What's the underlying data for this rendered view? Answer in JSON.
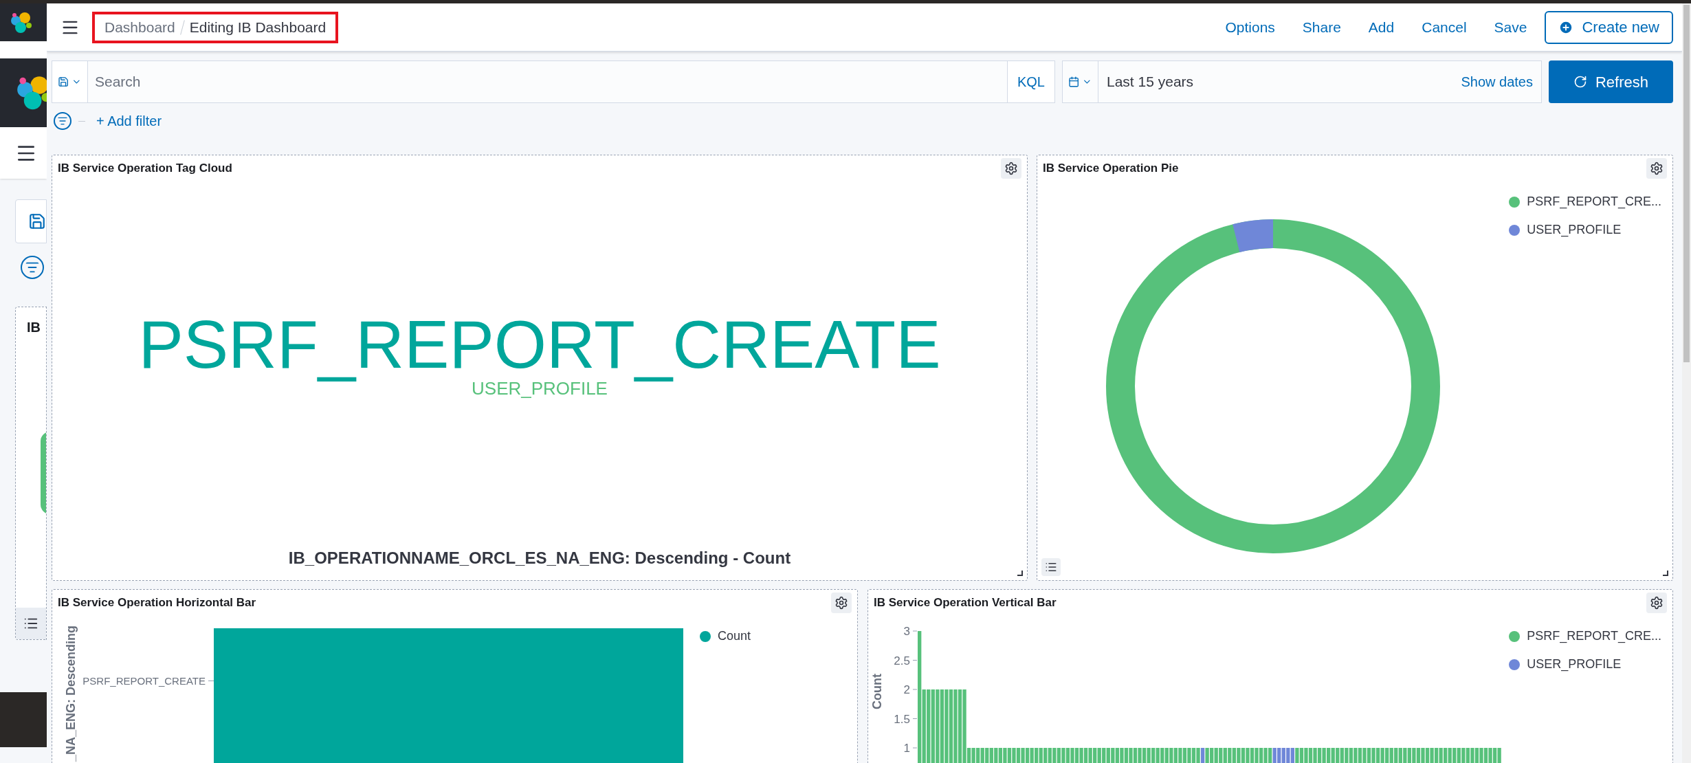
{
  "background_window": {
    "panel_title": "IB"
  },
  "header": {
    "breadcrumbs": {
      "highlighted": true,
      "items": [
        {
          "label": "Dashboard",
          "current": false
        },
        {
          "label": "Editing IB Dashboard",
          "current": true
        }
      ]
    },
    "actions": [
      {
        "label": "Options",
        "kind": "link"
      },
      {
        "label": "Share",
        "kind": "link"
      },
      {
        "label": "Add",
        "kind": "link"
      },
      {
        "label": "Cancel",
        "kind": "link"
      },
      {
        "label": "Save",
        "kind": "link"
      },
      {
        "label": "Create new",
        "kind": "create"
      }
    ]
  },
  "query_bar": {
    "search": {
      "placeholder": "Search"
    },
    "language": "KQL",
    "time": {
      "value": "Last 15 years",
      "toggle": "Show dates"
    },
    "refresh": "Refresh"
  },
  "filter_bar": {
    "add_filter": "+ Add filter"
  },
  "panels": [
    {
      "kind": "tag_cloud",
      "title": "IB Service Operation Tag Cloud",
      "words": [
        {
          "text": "PSRF_REPORT_CREATE",
          "kind": "large",
          "color": "#00a69b"
        },
        {
          "text": "USER_PROFILE",
          "kind": "small",
          "color": "#57c17b"
        }
      ],
      "caption": "IB_OPERATIONNAME_ORCL_ES_NA_ENG: Descending - Count"
    },
    {
      "kind": "pie",
      "title": "IB Service Operation Pie",
      "legend": [
        {
          "label": "PSRF_REPORT_CRE...",
          "color": "#57c17b"
        },
        {
          "label": "USER_PROFILE",
          "color": "#6f87d8"
        }
      ]
    },
    {
      "kind": "hbar",
      "title": "IB Service Operation Horizontal Bar",
      "axis_label": "_NA_ENG: Descending",
      "category": "PSRF_REPORT_CREATE",
      "legend": [
        {
          "label": "Count",
          "color": "#00a69b"
        }
      ]
    },
    {
      "kind": "vbar",
      "title": "IB Service Operation Vertical Bar",
      "chart_data": {
        "type": "bar",
        "ylabel": "Count",
        "ylim": [
          0,
          3
        ],
        "yticks": [
          1,
          1.5,
          2,
          2.5,
          3
        ],
        "stacked": true,
        "series": [
          {
            "name": "PSRF_REPORT_CRE...",
            "color": "#57c17b",
            "values": [
              3,
              2,
              2,
              2,
              2,
              2,
              2,
              2,
              2,
              2,
              2,
              1,
              1,
              1,
              1,
              1,
              1,
              1,
              1,
              1,
              1,
              1,
              1,
              1,
              1,
              1,
              1,
              1,
              1,
              1,
              1,
              1,
              1,
              1,
              1,
              1,
              1,
              1,
              1,
              1,
              1,
              1,
              1,
              1,
              1,
              1,
              1,
              1,
              1,
              1,
              1,
              1,
              1,
              1,
              1,
              1,
              1,
              1,
              1,
              1,
              1,
              1,
              1,
              null,
              1,
              1,
              1,
              1,
              1,
              1,
              1,
              1,
              1,
              1,
              1,
              1,
              1,
              1,
              1,
              null,
              null,
              null,
              null,
              null,
              1,
              1,
              1,
              1,
              1,
              1,
              1,
              1,
              1,
              1,
              1,
              1,
              1,
              1,
              1,
              1,
              1,
              1,
              1,
              1,
              1,
              1,
              1,
              1,
              1,
              1,
              1,
              1,
              1,
              1,
              1,
              1,
              1,
              1,
              1,
              1,
              1,
              1,
              1,
              1,
              1,
              1,
              1,
              1,
              1,
              1
            ]
          },
          {
            "name": "USER_PROFILE",
            "color": "#6f87d8",
            "values": [
              null,
              null,
              null,
              null,
              null,
              null,
              null,
              null,
              null,
              null,
              null,
              null,
              null,
              null,
              null,
              null,
              null,
              null,
              null,
              null,
              null,
              null,
              null,
              null,
              null,
              null,
              null,
              null,
              null,
              null,
              null,
              null,
              null,
              null,
              null,
              null,
              null,
              null,
              null,
              null,
              null,
              null,
              null,
              null,
              null,
              null,
              null,
              null,
              null,
              null,
              null,
              null,
              null,
              null,
              null,
              null,
              null,
              null,
              null,
              null,
              null,
              null,
              null,
              1,
              null,
              null,
              null,
              null,
              null,
              null,
              null,
              null,
              null,
              null,
              null,
              null,
              null,
              null,
              null,
              1,
              1,
              1,
              1,
              1,
              null,
              null,
              null,
              null,
              null,
              null,
              null,
              null,
              null,
              null,
              null,
              null,
              null,
              null,
              null,
              null,
              null,
              null,
              null,
              null,
              null,
              null,
              null,
              null,
              null,
              null,
              null,
              null,
              null,
              null,
              null,
              null,
              null,
              null,
              null,
              null,
              null,
              null,
              null,
              null,
              null,
              null,
              null,
              null,
              null,
              null
            ]
          }
        ]
      }
    }
  ]
}
